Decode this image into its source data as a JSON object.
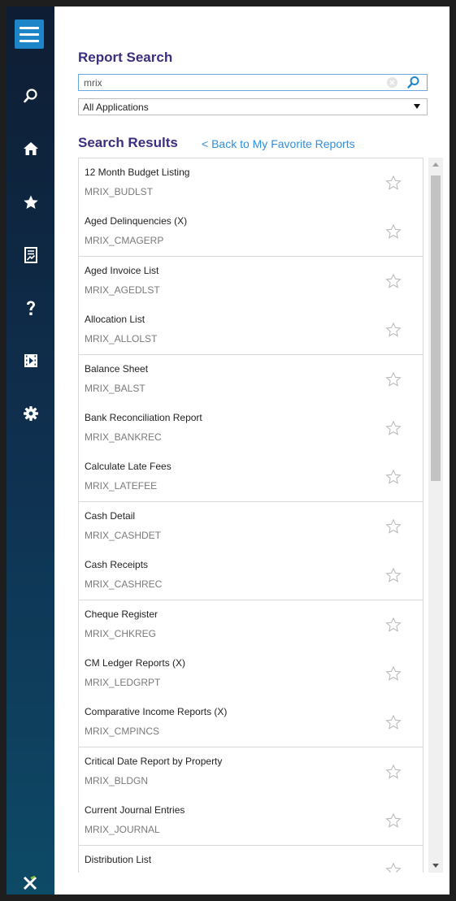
{
  "colors": {
    "accent": "#1e85c8",
    "heading": "#3a2f80",
    "link": "#2e8fe0",
    "sidebar_top": "#0e1d33",
    "sidebar_bottom": "#0d4a66"
  },
  "sidebar": {
    "items": [
      {
        "icon": "menu-icon"
      },
      {
        "icon": "search-icon"
      },
      {
        "icon": "home-icon"
      },
      {
        "icon": "star-icon"
      },
      {
        "icon": "report-icon"
      },
      {
        "icon": "help-icon"
      },
      {
        "icon": "film-icon"
      },
      {
        "icon": "gear-icon"
      }
    ],
    "logo": "mri-x-logo"
  },
  "search": {
    "title": "Report Search",
    "value": "mrix",
    "application_filter": "All Applications"
  },
  "results": {
    "title": "Search Results",
    "back_link": "< Back to My Favorite Reports",
    "items": [
      {
        "name": "12 Month Budget Listing",
        "code": "MRIX_BUDLST"
      },
      {
        "name": "Aged Delinquencies (X)",
        "code": "MRIX_CMAGERP"
      },
      {
        "name": "Aged Invoice List",
        "code": "MRIX_AGEDLST"
      },
      {
        "name": "Allocation List",
        "code": "MRIX_ALLOLST"
      },
      {
        "name": "Balance Sheet",
        "code": "MRIX_BALST"
      },
      {
        "name": "Bank Reconciliation Report",
        "code": "MRIX_BANKREC"
      },
      {
        "name": "Calculate Late Fees",
        "code": "MRIX_LATEFEE"
      },
      {
        "name": "Cash Detail",
        "code": "MRIX_CASHDET"
      },
      {
        "name": "Cash Receipts",
        "code": "MRIX_CASHREC"
      },
      {
        "name": "Cheque Register",
        "code": "MRIX_CHKREG"
      },
      {
        "name": "CM Ledger Reports (X)",
        "code": "MRIX_LEDGRPT"
      },
      {
        "name": "Comparative Income Reports (X)",
        "code": "MRIX_CMPINCS"
      },
      {
        "name": "Critical Date Report by Property",
        "code": "MRIX_BLDGN"
      },
      {
        "name": "Current Journal Entries",
        "code": "MRIX_JOURNAL"
      },
      {
        "name": "Distribution List",
        "code": ""
      }
    ]
  }
}
